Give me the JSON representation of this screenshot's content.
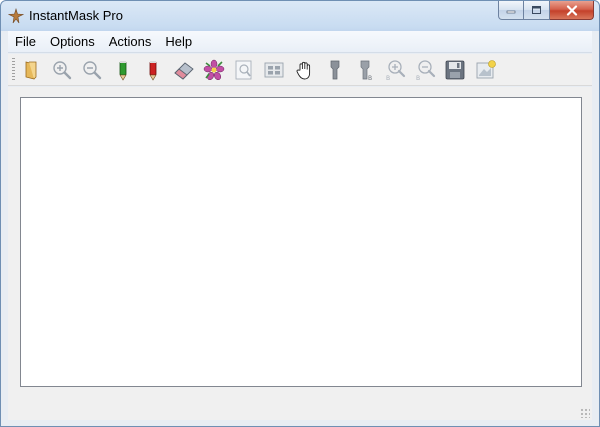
{
  "window": {
    "title": "InstantMask Pro",
    "icon": "instantmask-app-icon"
  },
  "caption": {
    "minimize_icon": "minimize-icon",
    "maximize_icon": "maximize-icon",
    "close_icon": "close-icon"
  },
  "menu": {
    "items": [
      {
        "label": "File"
      },
      {
        "label": "Options"
      },
      {
        "label": "Actions"
      },
      {
        "label": "Help"
      }
    ]
  },
  "toolbar": {
    "buttons": [
      {
        "icon": "open-folder-icon",
        "enabled": true
      },
      {
        "icon": "zoom-in-icon",
        "enabled": false
      },
      {
        "icon": "zoom-out-icon",
        "enabled": false
      },
      {
        "icon": "green-pencil-icon",
        "enabled": true
      },
      {
        "icon": "red-pencil-icon",
        "enabled": true
      },
      {
        "icon": "eraser-icon",
        "enabled": true
      },
      {
        "icon": "flower-icon",
        "enabled": true
      },
      {
        "icon": "preview-icon",
        "enabled": false
      },
      {
        "icon": "fit-view-icon",
        "enabled": false
      },
      {
        "icon": "hand-pan-icon",
        "enabled": true
      },
      {
        "icon": "brush-icon",
        "enabled": false
      },
      {
        "icon": "brush-b-icon",
        "enabled": false
      },
      {
        "icon": "zoom-in-b-icon",
        "enabled": false
      },
      {
        "icon": "zoom-out-b-icon",
        "enabled": false
      },
      {
        "icon": "save-icon",
        "enabled": false
      },
      {
        "icon": "export-icon",
        "enabled": false
      }
    ]
  },
  "colors": {
    "titlebar": "#c8dcf1",
    "client_bg": "#f0f0f0",
    "canvas_bg": "#ffffff",
    "close_red": "#c4412b"
  }
}
